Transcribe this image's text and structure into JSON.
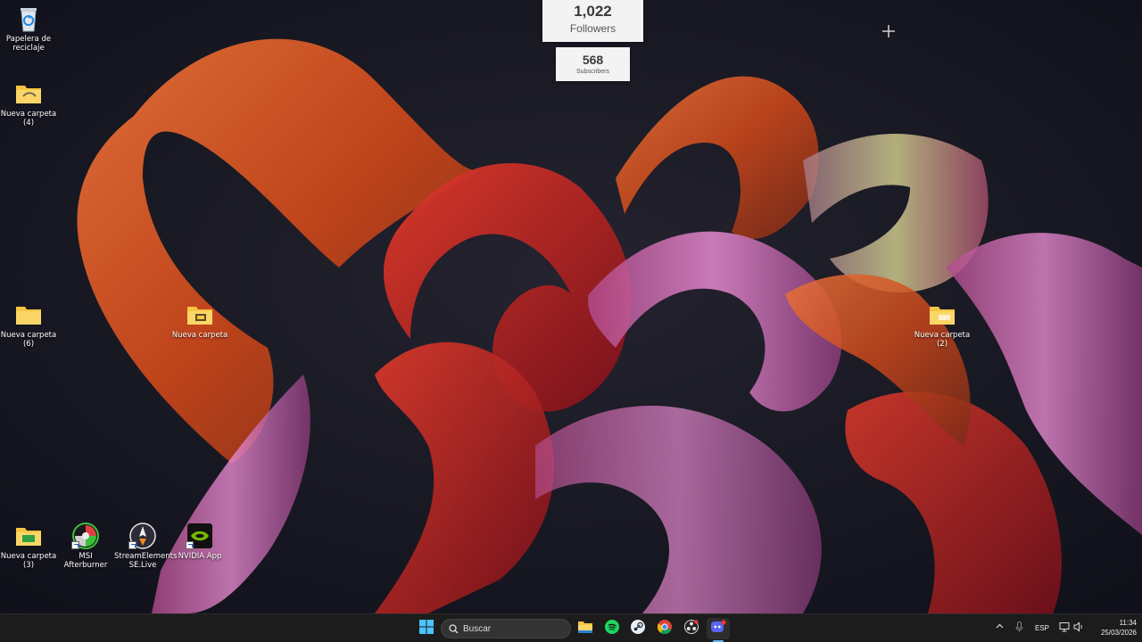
{
  "desktop": {
    "icons": [
      {
        "label": "Papelera de\nreciclaje",
        "icon": "recycle-bin-icon"
      },
      {
        "label": "Nueva carpeta\n(4)",
        "icon": "folder-icon"
      },
      {
        "label": "Nueva carpeta\n(6)",
        "icon": "folder-icon"
      },
      {
        "label": "Nueva carpeta",
        "icon": "folder-icon"
      },
      {
        "label": "Nueva carpeta\n(2)",
        "icon": "folder-icon"
      },
      {
        "label": "Nueva carpeta\n(3)",
        "icon": "folder-icon"
      },
      {
        "label": "MSI Afterburner",
        "icon": "msi-afterburner-icon"
      },
      {
        "label": "StreamElements\nSE.Live",
        "icon": "streamelements-icon"
      },
      {
        "label": "NVIDIA App",
        "icon": "nvidia-icon"
      }
    ]
  },
  "widgets": {
    "followers": {
      "count": "1,022",
      "label": "Followers"
    },
    "subscribers": {
      "count": "568",
      "label": "Subscribers"
    }
  },
  "taskbar": {
    "search_placeholder": "Buscar",
    "apps": [
      "start-icon",
      "file-explorer-icon",
      "spotify-icon",
      "steam-icon",
      "chrome-icon",
      "obs-icon",
      "discord-icon"
    ],
    "tray": {
      "language": "ESP",
      "time": "11:34",
      "date": "25/03/2026"
    }
  },
  "colors": {
    "desktop_bg": "#14151f",
    "taskbar_bg": "#1c1c1c",
    "folder": "#f6c543",
    "ribbon_orange": "#d85a1c",
    "ribbon_red": "#c41a1a",
    "ribbon_pink": "#d05aa0"
  }
}
